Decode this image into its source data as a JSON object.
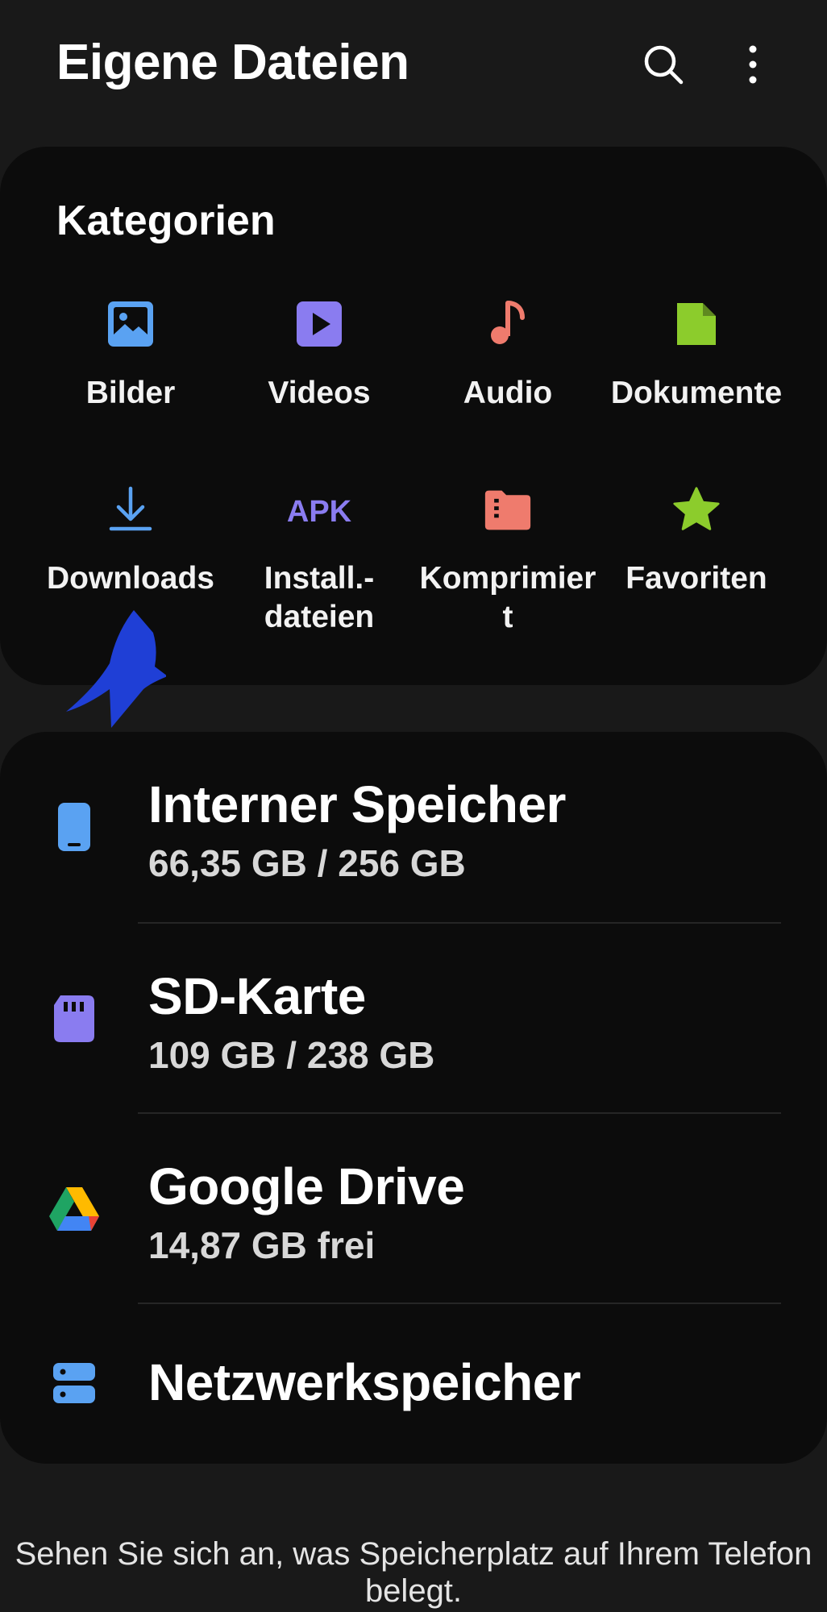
{
  "header": {
    "title": "Eigene Dateien",
    "search_icon": "search-icon",
    "more_icon": "more-vert-icon"
  },
  "categories": {
    "heading": "Kategorien",
    "items": [
      {
        "label": "Bilder",
        "icon": "image-icon",
        "color": "#5aa2f2"
      },
      {
        "label": "Videos",
        "icon": "video-icon",
        "color": "#8a7cf0"
      },
      {
        "label": "Audio",
        "icon": "music-note-icon",
        "color": "#ef7b6d"
      },
      {
        "label": "Dokumente",
        "icon": "document-icon",
        "color": "#8ccc2c"
      },
      {
        "label": "Downloads",
        "icon": "download-icon",
        "color": "#5aa2f2"
      },
      {
        "label": "Install.-\ndateien",
        "icon": "apk-icon",
        "color": "#8a7cf0"
      },
      {
        "label": "Komprimier\nt",
        "icon": "archive-folder-icon",
        "color": "#ef7b6d"
      },
      {
        "label": "Favoriten",
        "icon": "star-icon",
        "color": "#8ccc2c"
      }
    ]
  },
  "storage": {
    "items": [
      {
        "name": "Interner Speicher",
        "detail": "66,35 GB / 256 GB",
        "icon": "phone-icon",
        "color": "#5aa2f2"
      },
      {
        "name": "SD-Karte",
        "detail": "109 GB / 238 GB",
        "icon": "sd-card-icon",
        "color": "#8a7cf0"
      },
      {
        "name": "Google Drive",
        "detail": "14,87 GB frei",
        "icon": "google-drive-icon",
        "color": "#1fa463"
      },
      {
        "name": "Netzwerkspeicher",
        "icon": "network-storage-icon",
        "color": "#5aa2f2"
      }
    ]
  },
  "footer": {
    "text": "Sehen Sie sich an, was Speicherplatz auf Ihrem Telefon belegt."
  },
  "colors": {
    "background": "#191919",
    "card": "#0c0c0c",
    "annotation_pointer": "#1f3fd6"
  }
}
